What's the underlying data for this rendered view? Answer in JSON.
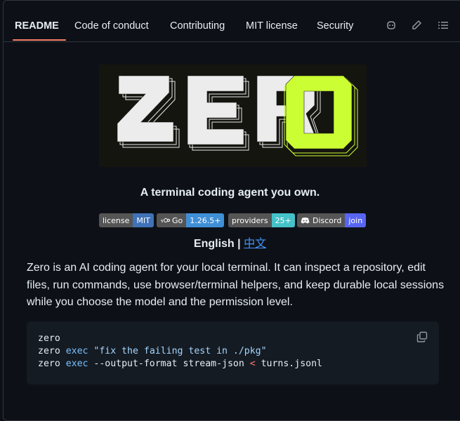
{
  "tabs": [
    {
      "label": "README"
    },
    {
      "label": "Code of conduct"
    },
    {
      "label": "Contributing"
    },
    {
      "label": "MIT license"
    },
    {
      "label": "Security"
    }
  ],
  "toolbar_icons": [
    "copilot-icon",
    "edit-pencil-icon",
    "outline-list-icon"
  ],
  "banner": {
    "letters": "ZERO",
    "accent": "#ccff33"
  },
  "tagline": "A terminal coding agent you own.",
  "badges": [
    {
      "key": "license",
      "value": "MIT",
      "color": "#3f72b6"
    },
    {
      "key": "Go",
      "value": "1.26.5+",
      "color": "#3f8fd6",
      "icon": "go-icon"
    },
    {
      "key": "providers",
      "value": "25+",
      "color": "#44c2c8"
    },
    {
      "key": "Discord",
      "value": "join",
      "color": "#5865f2",
      "icon": "discord-icon"
    }
  ],
  "languages": {
    "current": "English",
    "separator": " | ",
    "other": "中文"
  },
  "description": "Zero is an AI coding agent for your local terminal. It can inspect a repository, edit files, run commands, use browser/terminal helpers, and keep durable local sessions while you choose the model and the permission level.",
  "code": {
    "lines": [
      [
        "zero"
      ],
      [
        "zero ",
        "exec",
        " ",
        "\"fix the failing test in ./pkg\""
      ],
      [
        "zero ",
        "exec",
        " --output-format stream-json ",
        "<",
        " turns.jsonl"
      ]
    ]
  }
}
